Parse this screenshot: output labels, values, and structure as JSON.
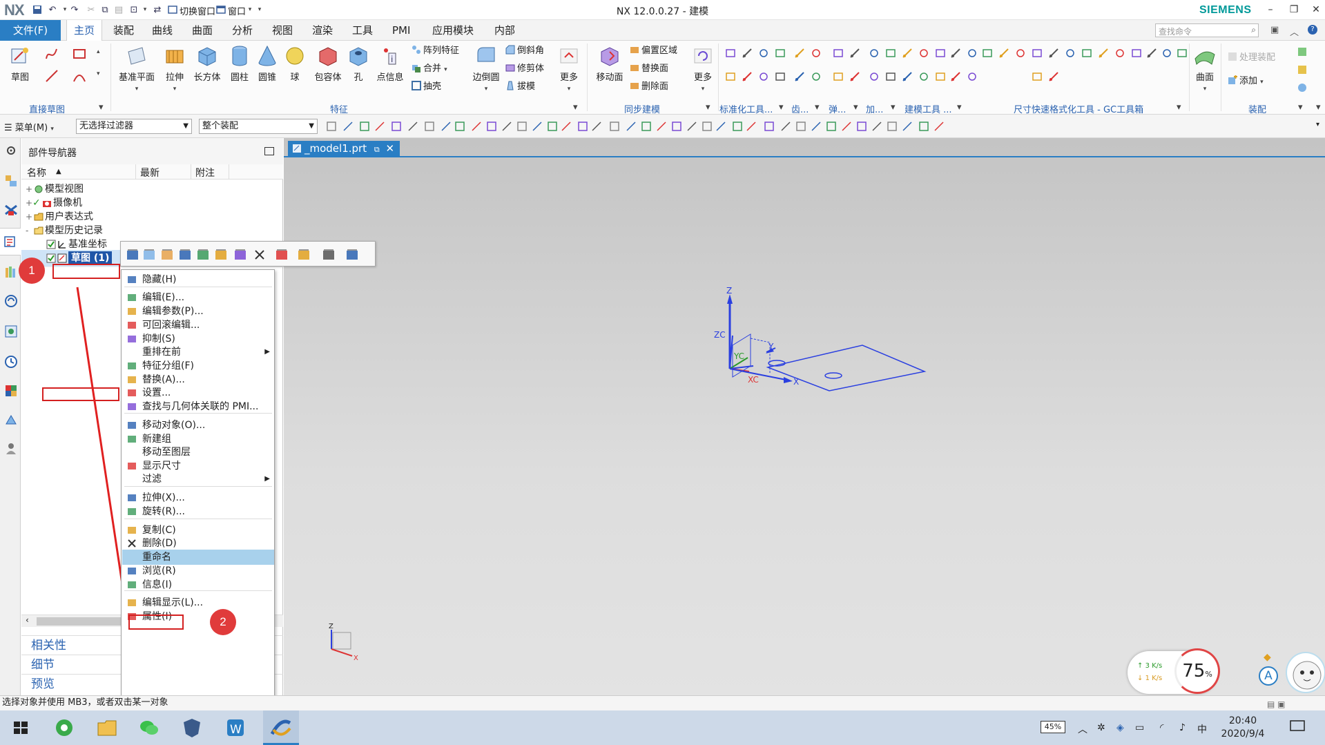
{
  "app": {
    "title": "NX 12.0.0.27 - 建模",
    "brand": "SIEMENS",
    "logo": "NX",
    "quick_access": {
      "switch_window": "切换窗口",
      "window_menu": "窗口"
    }
  },
  "ribbon_tabs": {
    "file": "文件(F)",
    "tabs": [
      "主页",
      "装配",
      "曲线",
      "曲面",
      "分析",
      "视图",
      "渲染",
      "工具",
      "PMI",
      "应用模块",
      "内部"
    ],
    "active_index": 0,
    "search_placeholder": "查找命令"
  },
  "ribbon": {
    "direct_sketch": {
      "sketch": "草图",
      "footer": "直接草图"
    },
    "feature": {
      "buttons": [
        "基准平面",
        "拉伸",
        "长方体",
        "圆柱",
        "圆锥",
        "球",
        "包容体",
        "孔",
        "点信息"
      ],
      "small": [
        "阵列特征",
        "合并",
        "抽壳",
        "边倒圆",
        "倒斜角",
        "修剪体",
        "拔模"
      ],
      "more": "更多",
      "footer": "特征"
    },
    "sync": {
      "move_face": "移动面",
      "small": [
        "偏置区域",
        "替换面",
        "删除面"
      ],
      "more": "更多",
      "footer": "同步建模"
    },
    "footers_right": [
      "标准化工具...",
      "齿...",
      "弹...",
      "加...",
      "建模工具 ...",
      "尺寸快速格式化工具 - GC工具箱"
    ],
    "assembly": {
      "surface": "曲面",
      "process_assembly": "处理装配",
      "add": "添加",
      "footer": "装配"
    }
  },
  "filterbar": {
    "menu": "菜单(M)",
    "filter": "无选择过滤器",
    "scope": "整个装配"
  },
  "navigator": {
    "title": "部件导航器",
    "columns": [
      "名称",
      "最新",
      "附注"
    ],
    "nodes": [
      {
        "label": "模型视图",
        "icon": "model-views-icon",
        "expander": "+"
      },
      {
        "label": "摄像机",
        "icon": "camera-icon",
        "expander": "+"
      },
      {
        "label": "用户表达式",
        "icon": "folder-icon",
        "expander": "+"
      },
      {
        "label": "模型历史记录",
        "icon": "folder-open-icon",
        "expander": "-"
      },
      {
        "label": "基准坐标",
        "icon": "datum-csys-icon",
        "expander": ""
      },
      {
        "label": "草图 (1)",
        "icon": "sketch-icon",
        "expander": ""
      }
    ],
    "bottom_tabs": [
      "相关性",
      "细节",
      "预览"
    ]
  },
  "document_tab": {
    "label": "_model1.prt"
  },
  "context_menu": {
    "items": [
      {
        "label": "隐藏(H)",
        "icon": "hide-icon"
      },
      {
        "label": "编辑(E)...",
        "icon": "edit-sketch-icon"
      },
      {
        "label": "编辑参数(P)...",
        "icon": "edit-parameters-icon"
      },
      {
        "label": "可回滚编辑...",
        "icon": "rollback-edit-icon"
      },
      {
        "label": "抑制(S)",
        "icon": "suppress-icon"
      },
      {
        "label": "重排在前",
        "icon": "",
        "submenu": true
      },
      {
        "label": "特征分组(F)",
        "icon": "feature-group-icon"
      },
      {
        "label": "替换(A)...",
        "icon": "replace-icon"
      },
      {
        "label": "设置...",
        "icon": "settings-icon"
      },
      {
        "label": "查找与几何体关联的 PMI...",
        "icon": "find-pmi-icon"
      },
      {
        "label": "移动对象(O)...",
        "icon": "move-object-icon"
      },
      {
        "label": "新建组",
        "icon": "new-group-icon"
      },
      {
        "label": "移动至图层",
        "icon": ""
      },
      {
        "label": "显示尺寸",
        "icon": "show-dimensions-icon"
      },
      {
        "label": "过滤",
        "icon": "",
        "submenu": true
      },
      {
        "label": "拉伸(X)...",
        "icon": "extrude-icon"
      },
      {
        "label": "旋转(R)...",
        "icon": "revolve-icon"
      },
      {
        "label": "复制(C)",
        "icon": "copy-icon"
      },
      {
        "label": "删除(D)",
        "icon": "delete-icon"
      },
      {
        "label": "重命名",
        "icon": "",
        "highlighted": true
      },
      {
        "label": "浏览(R)",
        "icon": "browse-icon"
      },
      {
        "label": "信息(I)",
        "icon": "info-icon"
      },
      {
        "label": "编辑显示(L)...",
        "icon": "edit-display-icon"
      },
      {
        "label": "属性(I)",
        "icon": "properties-icon"
      }
    ]
  },
  "callouts": [
    "1",
    "2"
  ],
  "viewport": {
    "axes": {
      "z": "Z",
      "zc": "ZC",
      "yc": "YC",
      "y": "Y",
      "xc": "XC",
      "x": "X"
    },
    "triad": {
      "z": "Z",
      "x": "X"
    }
  },
  "status": {
    "message": "选择对象并使用 MB3，或者双击某一对象"
  },
  "network_widget": {
    "up": "3 K/s",
    "down": "1 K/s",
    "gauge_value": "75",
    "gauge_unit": "%"
  },
  "taskbar": {
    "battery": "45%",
    "time": "20:40",
    "date": "2020/9/4"
  },
  "colors": {
    "accent": "#2a7ec4",
    "brand": "#009999",
    "highlight": "#a8d1ec",
    "callout": "#e03b3b",
    "sketch": "#2a3fe0"
  }
}
